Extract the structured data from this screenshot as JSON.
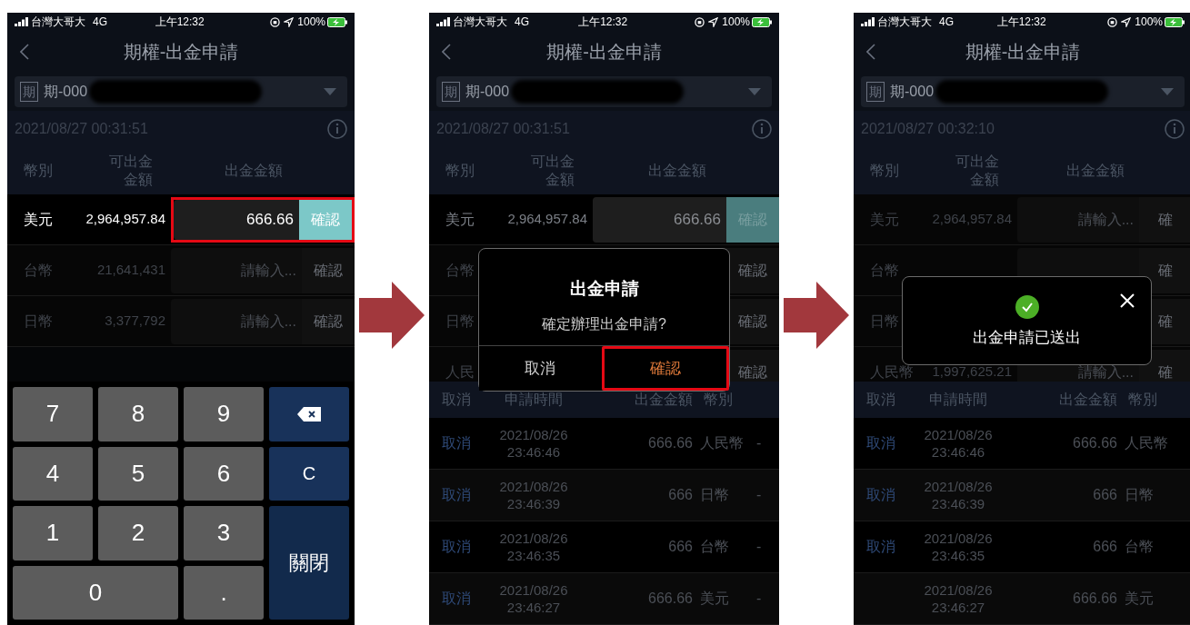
{
  "screens": [
    {
      "status": {
        "carrier": "台灣大哥大",
        "network": "4G",
        "time": "上午12:32",
        "battery": "100%"
      },
      "title": "期權-出金申請",
      "account": {
        "badge": "期",
        "value": "期-000"
      },
      "timestamp": "2021/08/27 00:31:51",
      "columns": [
        "幣別",
        "可出金金額",
        "出金金額"
      ],
      "balances": [
        {
          "currency": "美元",
          "available": "2,964,957.84",
          "amount": "666.66",
          "confirm": "確認",
          "active": true,
          "highlighted": true
        },
        {
          "currency": "台幣",
          "available": "21,641,431",
          "placeholder": "請輸入...",
          "confirm": "確認",
          "active": false,
          "highlighted": false
        },
        {
          "currency": "日幣",
          "available": "3,377,792",
          "placeholder": "請輸入...",
          "confirm": "確認",
          "active": false,
          "highlighted": false
        }
      ],
      "overlay": {
        "kind": "keypad",
        "keys": [
          {
            "kind": "digit",
            "label": "7"
          },
          {
            "kind": "digit",
            "label": "8"
          },
          {
            "kind": "digit",
            "label": "9"
          },
          {
            "kind": "backspace"
          },
          {
            "kind": "digit",
            "label": "4"
          },
          {
            "kind": "digit",
            "label": "5"
          },
          {
            "kind": "digit",
            "label": "6"
          },
          {
            "kind": "action",
            "label": "C"
          },
          {
            "kind": "digit",
            "label": "1"
          },
          {
            "kind": "digit",
            "label": "2"
          },
          {
            "kind": "digit",
            "label": "3"
          },
          {
            "kind": "close",
            "label": "關閉"
          },
          {
            "kind": "wide",
            "label": "0"
          },
          {
            "kind": "digit",
            "label": "."
          }
        ]
      }
    },
    {
      "status": {
        "carrier": "台灣大哥大",
        "network": "4G",
        "time": "上午12:32",
        "battery": "100%"
      },
      "title": "期權-出金申請",
      "account": {
        "badge": "期",
        "value": "期-000"
      },
      "timestamp": "2021/08/27 00:31:51",
      "columns": [
        "幣別",
        "可出金金額",
        "出金金額"
      ],
      "balances": [
        {
          "currency": "美元",
          "available": "2,964,957.84",
          "amount": "666.66",
          "confirm": "確認",
          "active": true,
          "highlighted": false
        },
        {
          "currency": "台幣",
          "confirm": "確認",
          "active": false,
          "highlighted": false
        },
        {
          "currency": "日幣",
          "confirm": "確認",
          "active": false,
          "highlighted": false
        },
        {
          "currency": "人民",
          "confirm": "確認",
          "active": false,
          "highlighted": false
        }
      ],
      "history": {
        "columns": [
          "取消",
          "申請時間",
          "出金金額",
          "幣別"
        ],
        "rows": [
          {
            "cancel": "取消",
            "date": "2021/08/26",
            "time": "23:46:46",
            "amount": "666.66",
            "currency": "人民幣",
            "extra": "-"
          },
          {
            "cancel": "取消",
            "date": "2021/08/26",
            "time": "23:46:39",
            "amount": "666",
            "currency": "日幣",
            "extra": "-"
          },
          {
            "cancel": "取消",
            "date": "2021/08/26",
            "time": "23:46:35",
            "amount": "666",
            "currency": "台幣",
            "extra": "-"
          },
          {
            "cancel": "取消",
            "date": "2021/08/26",
            "time": "23:46:27",
            "amount": "666.66",
            "currency": "美元",
            "extra": "-"
          }
        ]
      },
      "overlay": {
        "kind": "dialog",
        "title": "出金申請",
        "message": "確定辦理出金申請?",
        "buttons": [
          {
            "label": "取消",
            "highlighted": false
          },
          {
            "label": "確認",
            "highlighted": true
          }
        ]
      }
    },
    {
      "status": {
        "carrier": "台灣大哥大",
        "network": "4G",
        "time": "上午12:32",
        "battery": "100%"
      },
      "title": "期權-出金申請",
      "account": {
        "badge": "期",
        "value": "期-000"
      },
      "timestamp": "2021/08/27 00:32:10",
      "columns": [
        "幣別",
        "可出金金額",
        "出金金額"
      ],
      "balances": [
        {
          "currency": "美元",
          "available": "2,964,957.84",
          "placeholder": "請輸入...",
          "confirm": "確",
          "active": false,
          "highlighted": false
        },
        {
          "currency": "台幣",
          "confirm": "確",
          "active": false,
          "highlighted": false
        },
        {
          "currency": "日幣",
          "confirm": "確",
          "active": false,
          "highlighted": false
        },
        {
          "currency": "人民幣",
          "available": "1,997,625.21",
          "placeholder": "請輸入...",
          "confirm": "確",
          "active": false,
          "highlighted": false
        }
      ],
      "history": {
        "columns": [
          "取消",
          "申請時間",
          "出金金額",
          "幣別"
        ],
        "rows": [
          {
            "cancel": "取消",
            "date": "2021/08/26",
            "time": "23:46:46",
            "amount": "666.66",
            "currency": "人民幣"
          },
          {
            "cancel": "取消",
            "date": "2021/08/26",
            "time": "23:46:39",
            "amount": "666",
            "currency": "日幣"
          },
          {
            "cancel": "取消",
            "date": "2021/08/26",
            "time": "23:46:35",
            "amount": "666",
            "currency": "台幣"
          },
          {
            "date": "2021/08/26",
            "time": "23:46:27",
            "amount": "666.66",
            "currency": "美元"
          }
        ]
      },
      "overlay": {
        "kind": "toast",
        "message": "出金申請已送出"
      }
    }
  ]
}
